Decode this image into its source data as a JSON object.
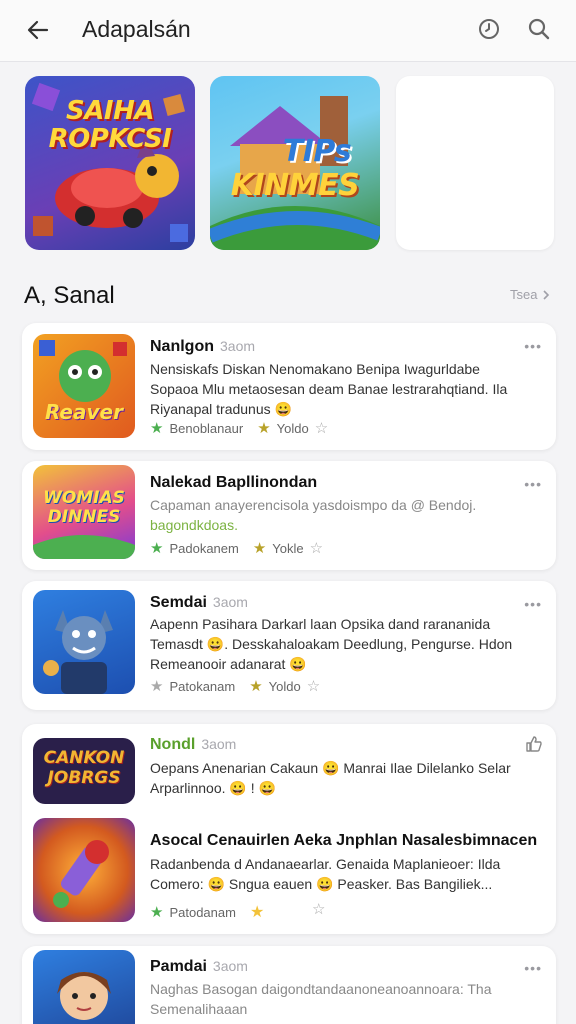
{
  "header": {
    "title": "Adapalsán",
    "back_icon": "arrow-left-icon",
    "history_icon": "clock-icon",
    "search_icon": "search-icon"
  },
  "banners": [
    {
      "line1": "SAIHA",
      "line2": "ROPKCSI"
    },
    {
      "line1": "TIPs",
      "line2": "KINMES"
    },
    {
      "line1": "",
      "line2": ""
    }
  ],
  "section": {
    "title": "A, Sanal",
    "see_all": "Tsea"
  },
  "apps": [
    {
      "name": "Nanlgon",
      "time": "3aom",
      "desc1": "Nensiskafs Diskan Nenomakano Benipa Iwagurldabe",
      "desc2": "Sopaoa Mlu metaosesan deam Banae lestrarahqtiand. Ila",
      "desc3": "Riyanapal tradunus 😀",
      "meta1": "Benoblanaur",
      "meta2": "Yoldo",
      "icon_text": "Reaver"
    },
    {
      "name": "Nalekad Bapllinondan",
      "time": "",
      "desc1": "Capaman anayerencisola yasdoismpo da @ Bendoj.",
      "desc2": "bagondkdoas.",
      "desc3": "",
      "meta1": "Padokanem",
      "meta2": "Yokle",
      "icon_text": "WOMIAS DINNES"
    },
    {
      "name": "Semdai",
      "time": "3aom",
      "desc1": "Aapenn Pasihara Darkarl laan Opsika dand rarananida",
      "desc2": "Temasdt 😀. Desskahaloakam Deedlung, Pengurse. Hdon",
      "desc3": "Remeanooir adanarat 😀",
      "meta1": "Patokanam",
      "meta2": "Yoldo",
      "icon_text": ""
    },
    {
      "name": "Nondl",
      "time": "3aom",
      "desc1": "Oepans Anenarian Cakaun 😀 Manrai Ilae Dilelanko Selar",
      "desc2": "Arparlinnoo. 😀 ! 😀",
      "desc3": "",
      "meta1": "",
      "meta2": "",
      "icon_text": "CANKON JOBRGS"
    },
    {
      "name": "Asocal Cenauirlen Aeka Jnphlan Nasalesbimnacen",
      "time": "",
      "desc1": "Radanbenda d Andanaearlar. Genaida Maplanieoer: Ilda",
      "desc2": "Comero: 😀 Sngua eauen 😀 Peasker. Bas Bangiliek...",
      "desc3": "",
      "meta1": "Patodanam",
      "meta2": "",
      "icon_text": ""
    },
    {
      "name": "Pamdai",
      "time": "3aom",
      "desc1": "Naghas Basogan daigondtandaanoneanoannoara: Tha",
      "desc2": "Semenalihaaan",
      "desc3": "",
      "meta1": "",
      "meta2": "",
      "icon_text": ""
    }
  ],
  "colors": {
    "accent_green": "#4caf50",
    "star_gold": "#b8a22a",
    "background": "#f4f4f6"
  }
}
